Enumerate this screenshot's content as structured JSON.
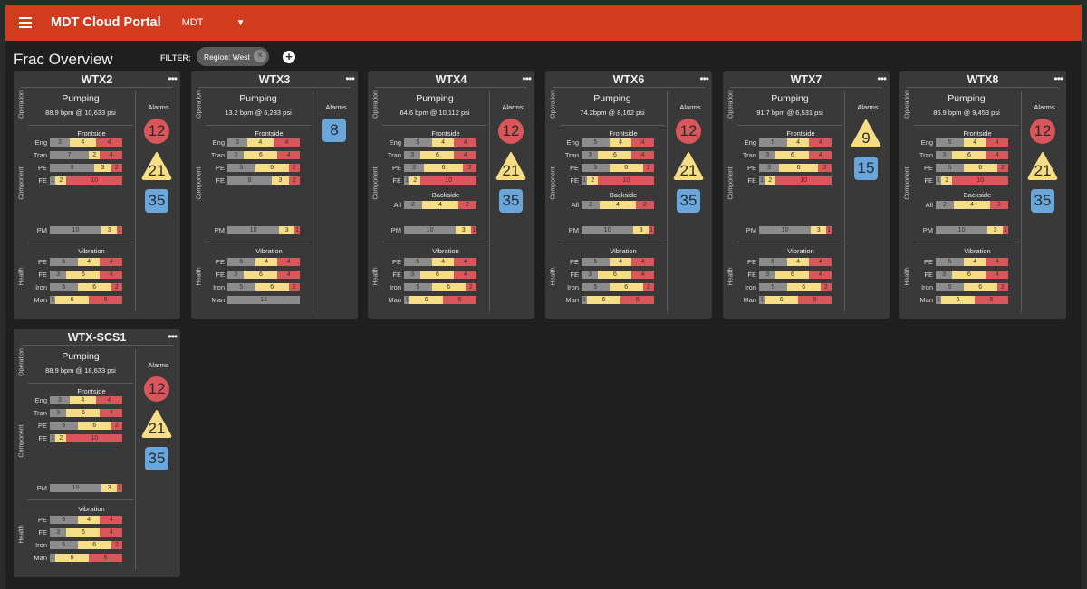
{
  "header": {
    "app_title": "MDT Cloud Portal",
    "tenant": "MDT"
  },
  "subheader": {
    "page_title": "Frac Overview",
    "filter_label": "FILTER:",
    "filter_chip": "Region: West"
  },
  "labels": {
    "operation": "Operation",
    "component": "Component",
    "health": "Health",
    "pumping": "Pumping",
    "alarms": "Alarms",
    "frontside": "Frontside",
    "backside": "Backside",
    "vibration": "Vibration"
  },
  "cards": [
    {
      "name": "WTX2",
      "rate": "88.9 bpm @ 10,633 psi",
      "frontside": [
        {
          "label": "Eng",
          "segs": [
            [
              "g",
              3
            ],
            [
              "y",
              4
            ],
            [
              "r",
              4
            ]
          ]
        },
        {
          "label": "Tran",
          "segs": [
            [
              "g",
              7
            ],
            [
              "y",
              2
            ],
            [
              "r",
              4
            ]
          ]
        },
        {
          "label": "PE",
          "segs": [
            [
              "g",
              8
            ],
            [
              "y",
              3
            ],
            [
              "r",
              2
            ]
          ]
        },
        {
          "label": "FE",
          "segs": [
            [
              "g",
              1
            ],
            [
              "y",
              2
            ],
            [
              "r",
              10
            ]
          ]
        }
      ],
      "backside": null,
      "pm": {
        "label": "PM",
        "segs": [
          [
            "g",
            10
          ],
          [
            "y",
            3
          ],
          [
            "r",
            1
          ]
        ]
      },
      "vibration": [
        {
          "label": "PE",
          "segs": [
            [
              "g",
              5
            ],
            [
              "y",
              4
            ],
            [
              "r",
              4
            ]
          ]
        },
        {
          "label": "FE",
          "segs": [
            [
              "g",
              3
            ],
            [
              "y",
              6
            ],
            [
              "r",
              4
            ]
          ]
        },
        {
          "label": "Iron",
          "segs": [
            [
              "g",
              5
            ],
            [
              "y",
              6
            ],
            [
              "r",
              2
            ]
          ]
        },
        {
          "label": "Man",
          "segs": [
            [
              "g",
              1
            ],
            [
              "y",
              6
            ],
            [
              "r",
              6
            ]
          ]
        }
      ],
      "alarms": {
        "critical": "12",
        "warning": "21",
        "info": "35"
      }
    },
    {
      "name": "WTX3",
      "rate": "13.2 bpm @ 6,233 psi",
      "frontside": [
        {
          "label": "Eng",
          "segs": [
            [
              "g",
              3
            ],
            [
              "y",
              4
            ],
            [
              "r",
              4
            ]
          ]
        },
        {
          "label": "Tran",
          "segs": [
            [
              "g",
              3
            ],
            [
              "y",
              6
            ],
            [
              "r",
              4
            ]
          ]
        },
        {
          "label": "PE",
          "segs": [
            [
              "g",
              5
            ],
            [
              "y",
              6
            ],
            [
              "r",
              2
            ]
          ]
        },
        {
          "label": "FE",
          "segs": [
            [
              "g",
              8
            ],
            [
              "y",
              3
            ],
            [
              "r",
              2
            ]
          ]
        }
      ],
      "backside": null,
      "pm": {
        "label": "PM",
        "segs": [
          [
            "g",
            10
          ],
          [
            "y",
            3
          ],
          [
            "r",
            1
          ]
        ]
      },
      "vibration": [
        {
          "label": "PE",
          "segs": [
            [
              "g",
              5
            ],
            [
              "y",
              4
            ],
            [
              "r",
              4
            ]
          ]
        },
        {
          "label": "FE",
          "segs": [
            [
              "g",
              3
            ],
            [
              "y",
              6
            ],
            [
              "r",
              4
            ]
          ]
        },
        {
          "label": "Iron",
          "segs": [
            [
              "g",
              5
            ],
            [
              "y",
              6
            ],
            [
              "r",
              2
            ]
          ]
        },
        {
          "label": "Man",
          "segs": [
            [
              "g",
              13
            ]
          ]
        }
      ],
      "alarms": {
        "critical": null,
        "warning": null,
        "info": "8"
      }
    },
    {
      "name": "WTX4",
      "rate": "64.6 bpm @ 10,112 psi",
      "frontside": [
        {
          "label": "Eng",
          "segs": [
            [
              "g",
              5
            ],
            [
              "y",
              4
            ],
            [
              "r",
              4
            ]
          ]
        },
        {
          "label": "Tran",
          "segs": [
            [
              "g",
              3
            ],
            [
              "y",
              6
            ],
            [
              "r",
              4
            ]
          ]
        },
        {
          "label": "PE",
          "segs": [
            [
              "g",
              3
            ],
            [
              "y",
              6
            ],
            [
              "r",
              2
            ]
          ]
        },
        {
          "label": "FE",
          "segs": [
            [
              "g",
              1
            ],
            [
              "y",
              2
            ],
            [
              "r",
              10
            ]
          ]
        }
      ],
      "backside": {
        "label": "All",
        "segs": [
          [
            "g",
            2
          ],
          [
            "y",
            4
          ],
          [
            "r",
            2
          ]
        ]
      },
      "pm": {
        "label": "PM",
        "segs": [
          [
            "g",
            10
          ],
          [
            "y",
            3
          ],
          [
            "r",
            1
          ]
        ]
      },
      "vibration": [
        {
          "label": "PE",
          "segs": [
            [
              "g",
              5
            ],
            [
              "y",
              4
            ],
            [
              "r",
              4
            ]
          ]
        },
        {
          "label": "FE",
          "segs": [
            [
              "g",
              3
            ],
            [
              "y",
              6
            ],
            [
              "r",
              4
            ]
          ]
        },
        {
          "label": "Iron",
          "segs": [
            [
              "g",
              5
            ],
            [
              "y",
              6
            ],
            [
              "r",
              2
            ]
          ]
        },
        {
          "label": "Man",
          "segs": [
            [
              "g",
              1
            ],
            [
              "y",
              6
            ],
            [
              "r",
              6
            ]
          ]
        }
      ],
      "alarms": {
        "critical": "12",
        "warning": "21",
        "info": "35"
      }
    },
    {
      "name": "WTX6",
      "rate": "74.2bpm @ 8,162 psi",
      "frontside": [
        {
          "label": "Eng",
          "segs": [
            [
              "g",
              5
            ],
            [
              "y",
              4
            ],
            [
              "r",
              4
            ]
          ]
        },
        {
          "label": "Tran",
          "segs": [
            [
              "g",
              3
            ],
            [
              "y",
              6
            ],
            [
              "r",
              4
            ]
          ]
        },
        {
          "label": "PE",
          "segs": [
            [
              "g",
              5
            ],
            [
              "y",
              6
            ],
            [
              "r",
              2
            ]
          ]
        },
        {
          "label": "FE",
          "segs": [
            [
              "g",
              1
            ],
            [
              "y",
              2
            ],
            [
              "r",
              10
            ]
          ]
        }
      ],
      "backside": {
        "label": "All",
        "segs": [
          [
            "g",
            2
          ],
          [
            "y",
            4
          ],
          [
            "r",
            2
          ]
        ]
      },
      "pm": {
        "label": "PM",
        "segs": [
          [
            "g",
            10
          ],
          [
            "y",
            3
          ],
          [
            "r",
            1
          ]
        ]
      },
      "vibration": [
        {
          "label": "PE",
          "segs": [
            [
              "g",
              5
            ],
            [
              "y",
              4
            ],
            [
              "r",
              4
            ]
          ]
        },
        {
          "label": "FE",
          "segs": [
            [
              "g",
              3
            ],
            [
              "y",
              6
            ],
            [
              "r",
              4
            ]
          ]
        },
        {
          "label": "Iron",
          "segs": [
            [
              "g",
              5
            ],
            [
              "y",
              6
            ],
            [
              "r",
              2
            ]
          ]
        },
        {
          "label": "Man",
          "segs": [
            [
              "g",
              1
            ],
            [
              "y",
              6
            ],
            [
              "r",
              6
            ]
          ]
        }
      ],
      "alarms": {
        "critical": "12",
        "warning": "21",
        "info": "35"
      }
    },
    {
      "name": "WTX7",
      "rate": "91.7 bpm @ 6,531 psi",
      "frontside": [
        {
          "label": "Eng",
          "segs": [
            [
              "g",
              5
            ],
            [
              "y",
              4
            ],
            [
              "r",
              4
            ]
          ]
        },
        {
          "label": "Tran",
          "segs": [
            [
              "g",
              3
            ],
            [
              "y",
              6
            ],
            [
              "r",
              4
            ]
          ]
        },
        {
          "label": "PE",
          "segs": [
            [
              "g",
              3
            ],
            [
              "y",
              6
            ],
            [
              "r",
              2
            ]
          ]
        },
        {
          "label": "FE",
          "segs": [
            [
              "g",
              1
            ],
            [
              "y",
              2
            ],
            [
              "r",
              10
            ]
          ]
        }
      ],
      "backside": null,
      "pm": {
        "label": "PM",
        "segs": [
          [
            "g",
            10
          ],
          [
            "y",
            3
          ],
          [
            "r",
            1
          ]
        ]
      },
      "vibration": [
        {
          "label": "PE",
          "segs": [
            [
              "g",
              5
            ],
            [
              "y",
              4
            ],
            [
              "r",
              4
            ]
          ]
        },
        {
          "label": "FE",
          "segs": [
            [
              "g",
              3
            ],
            [
              "y",
              6
            ],
            [
              "r",
              4
            ]
          ]
        },
        {
          "label": "Iron",
          "segs": [
            [
              "g",
              5
            ],
            [
              "y",
              6
            ],
            [
              "r",
              2
            ]
          ]
        },
        {
          "label": "Man",
          "segs": [
            [
              "g",
              1
            ],
            [
              "y",
              6
            ],
            [
              "r",
              6
            ]
          ]
        }
      ],
      "alarms": {
        "critical": null,
        "warning": "9",
        "info": "15"
      }
    },
    {
      "name": "WTX8",
      "rate": "86.9 bpm @ 9,453 psi",
      "frontside": [
        {
          "label": "Eng",
          "segs": [
            [
              "g",
              5
            ],
            [
              "y",
              4
            ],
            [
              "r",
              4
            ]
          ]
        },
        {
          "label": "Tran",
          "segs": [
            [
              "g",
              3
            ],
            [
              "y",
              6
            ],
            [
              "r",
              4
            ]
          ]
        },
        {
          "label": "PE",
          "segs": [
            [
              "g",
              5
            ],
            [
              "y",
              6
            ],
            [
              "r",
              2
            ]
          ]
        },
        {
          "label": "FE",
          "segs": [
            [
              "g",
              1
            ],
            [
              "y",
              2
            ],
            [
              "r",
              10
            ]
          ]
        }
      ],
      "backside": {
        "label": "All",
        "segs": [
          [
            "g",
            2
          ],
          [
            "y",
            4
          ],
          [
            "r",
            2
          ]
        ]
      },
      "pm": {
        "label": "PM",
        "segs": [
          [
            "g",
            10
          ],
          [
            "y",
            3
          ],
          [
            "r",
            1
          ]
        ]
      },
      "vibration": [
        {
          "label": "PE",
          "segs": [
            [
              "g",
              5
            ],
            [
              "y",
              4
            ],
            [
              "r",
              4
            ]
          ]
        },
        {
          "label": "FE",
          "segs": [
            [
              "g",
              3
            ],
            [
              "y",
              6
            ],
            [
              "r",
              4
            ]
          ]
        },
        {
          "label": "Iron",
          "segs": [
            [
              "g",
              5
            ],
            [
              "y",
              6
            ],
            [
              "r",
              2
            ]
          ]
        },
        {
          "label": "Man",
          "segs": [
            [
              "g",
              1
            ],
            [
              "y",
              6
            ],
            [
              "r",
              6
            ]
          ]
        }
      ],
      "alarms": {
        "critical": "12",
        "warning": "21",
        "info": "35"
      }
    },
    {
      "name": "WTX-SCS1",
      "rate": "88.9 bpm @ 18,633 psi",
      "frontside": [
        {
          "label": "Eng",
          "segs": [
            [
              "g",
              3
            ],
            [
              "y",
              4
            ],
            [
              "r",
              4
            ]
          ]
        },
        {
          "label": "Tran",
          "segs": [
            [
              "g",
              3
            ],
            [
              "y",
              6
            ],
            [
              "r",
              4
            ]
          ]
        },
        {
          "label": "PE",
          "segs": [
            [
              "g",
              5
            ],
            [
              "y",
              6
            ],
            [
              "r",
              2
            ]
          ]
        },
        {
          "label": "FE",
          "segs": [
            [
              "g",
              1
            ],
            [
              "y",
              2
            ],
            [
              "r",
              10
            ]
          ]
        }
      ],
      "backside": null,
      "pm": {
        "label": "PM",
        "segs": [
          [
            "g",
            10
          ],
          [
            "y",
            3
          ],
          [
            "r",
            1
          ]
        ]
      },
      "vibration": [
        {
          "label": "PE",
          "segs": [
            [
              "g",
              5
            ],
            [
              "y",
              4
            ],
            [
              "r",
              4
            ]
          ]
        },
        {
          "label": "FE",
          "segs": [
            [
              "g",
              3
            ],
            [
              "y",
              6
            ],
            [
              "r",
              4
            ]
          ]
        },
        {
          "label": "Iron",
          "segs": [
            [
              "g",
              5
            ],
            [
              "y",
              6
            ],
            [
              "r",
              2
            ]
          ]
        },
        {
          "label": "Man",
          "segs": [
            [
              "g",
              1
            ],
            [
              "y",
              6
            ],
            [
              "r",
              6
            ]
          ]
        }
      ],
      "alarms": {
        "critical": "12",
        "warning": "21",
        "info": "35"
      }
    }
  ],
  "colors": {
    "header": "#d33b1f",
    "critical": "#d9565a",
    "warning": "#f7dd86",
    "info": "#6aa6d9",
    "normal": "#8c8c8c"
  }
}
